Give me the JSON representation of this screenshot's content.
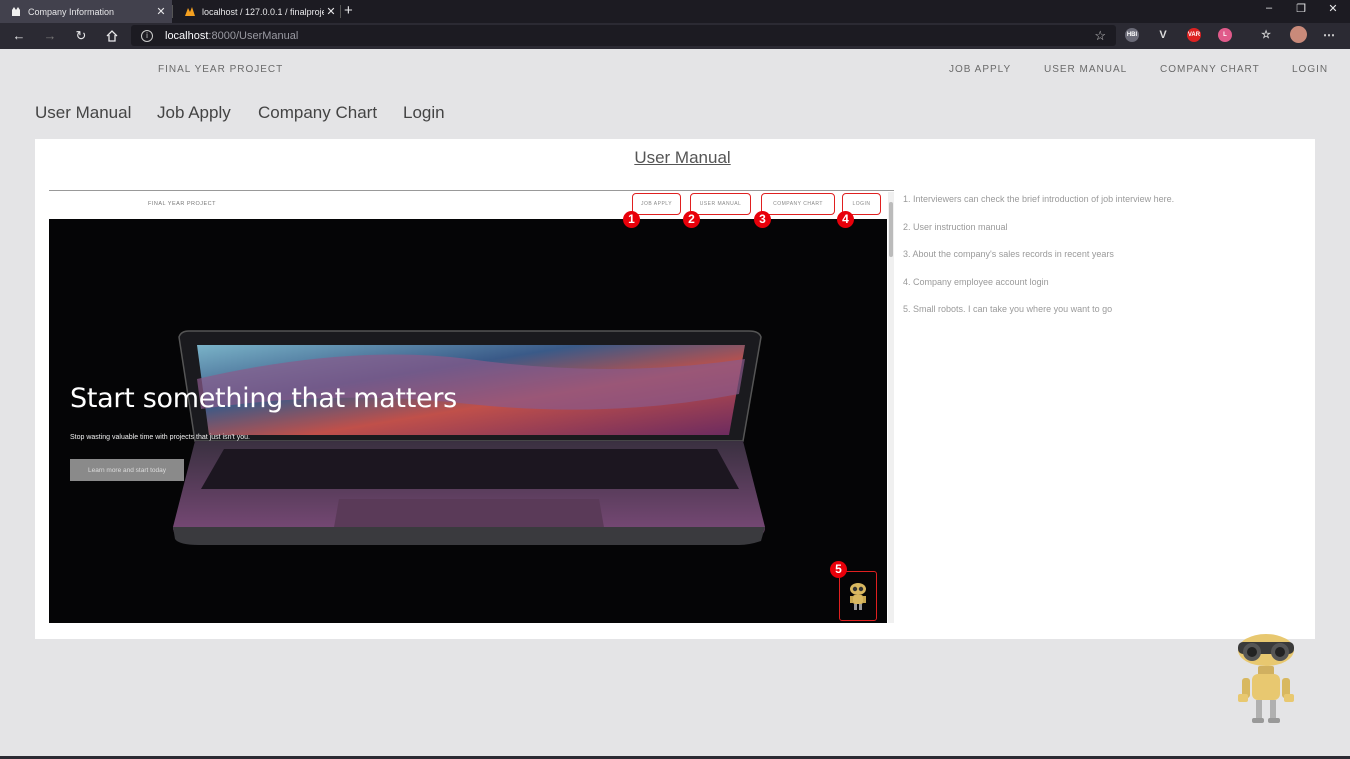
{
  "browser": {
    "tabs": [
      {
        "title": "Company Information",
        "active": true
      },
      {
        "title": "localhost / 127.0.0.1 / finalproje",
        "active": false
      }
    ],
    "url_host": "localhost",
    "url_path": ":8000/UserManual",
    "new_tab": "+",
    "close_glyph": "✕",
    "window_controls": [
      "–",
      "❐",
      "✕"
    ],
    "extensions": [
      "HBI",
      "V",
      "VAR",
      "L"
    ]
  },
  "site": {
    "brand": "FINAL YEAR PROJECT",
    "top_links": [
      "JOB APPLY",
      "USER MANUAL",
      "COMPANY CHART",
      "LOGIN"
    ],
    "sub_links": [
      "User Manual",
      "Job Apply",
      "Company Chart",
      "Login"
    ]
  },
  "card": {
    "title": "User Manual",
    "screenshot": {
      "brand": "FINAL YEAR PROJECT",
      "buttons": [
        "JOB APPLY",
        "USER MANUAL",
        "COMPANY CHART",
        "LOGIN"
      ],
      "badges": [
        "1",
        "2",
        "3",
        "4",
        "5"
      ],
      "hero_title": "Start something that matters",
      "hero_sub": "Stop wasting valuable time with projects that just isn't you.",
      "hero_button": "Learn more and start today"
    },
    "notes": [
      "1. Interviewers can check the brief introduction of job interview here.",
      "2. User instruction manual",
      "3. About the company's sales records in recent years",
      "4. Company employee account login",
      "5. Small robots. I can take you where you want to go"
    ]
  },
  "colors": {
    "accent_red": "#e02020",
    "page_bg": "#e4e4e6",
    "chrome_dark": "#2b2a33"
  }
}
